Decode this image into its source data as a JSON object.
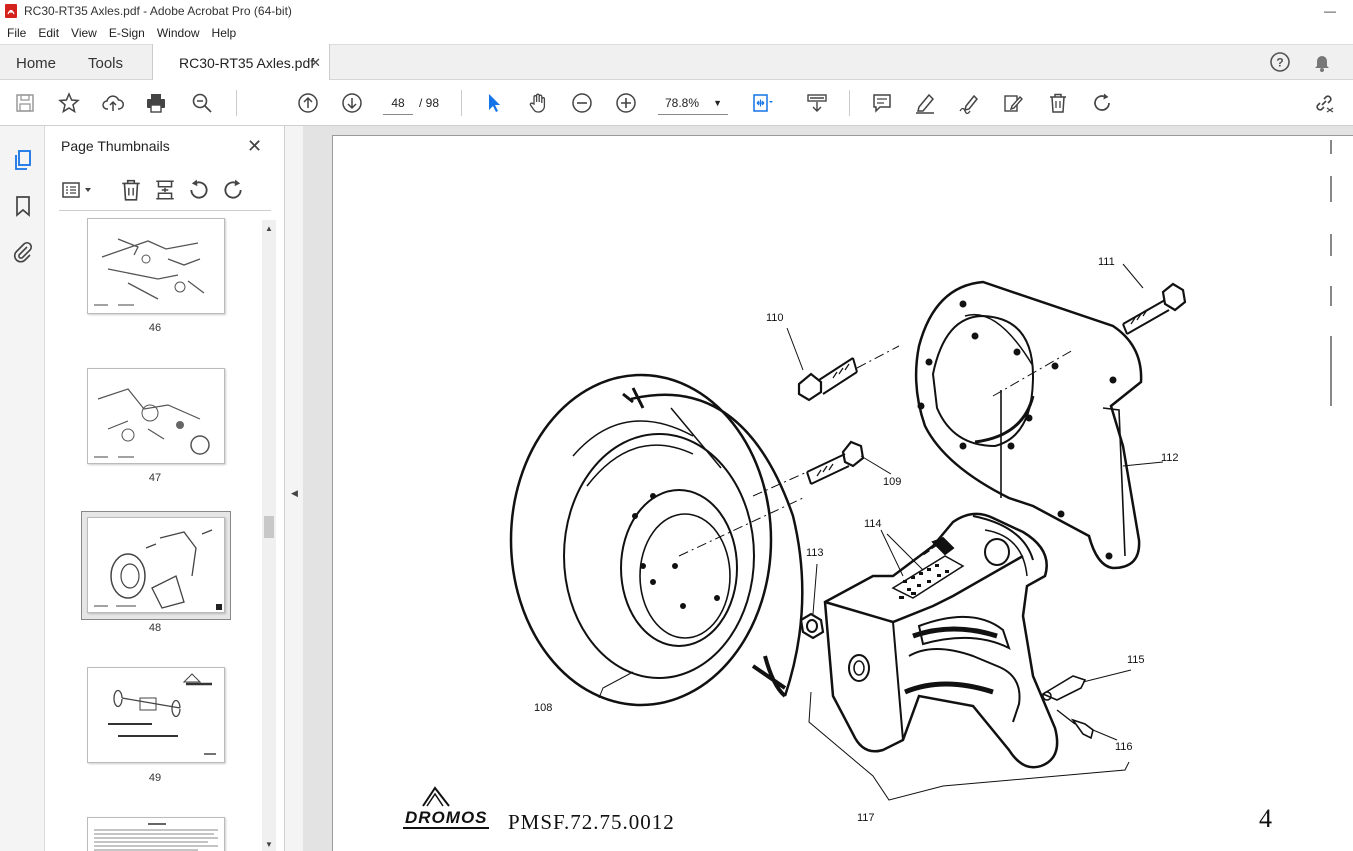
{
  "window": {
    "title": "RC30-RT35 Axles.pdf - Adobe Acrobat Pro (64-bit)"
  },
  "menu": [
    "File",
    "Edit",
    "View",
    "E-Sign",
    "Window",
    "Help"
  ],
  "tabs": {
    "home": "Home",
    "tools": "Tools",
    "document": "RC30-RT35 Axles.pdf"
  },
  "toolbar": {
    "current_page": "48",
    "total_pages": "/ 98",
    "zoom": "78.8%"
  },
  "thumbnails": {
    "title": "Page Thumbnails",
    "pages": [
      {
        "label": "46"
      },
      {
        "label": "47"
      },
      {
        "label": "48",
        "selected": true
      },
      {
        "label": "49"
      }
    ]
  },
  "document": {
    "callouts": [
      "111",
      "110",
      "112",
      "109",
      "114",
      "113",
      "115",
      "108",
      "116",
      "117"
    ],
    "brand": "DROMOS",
    "code": "PMSF.72.75.0012",
    "page_number": "4"
  },
  "colors": {
    "accent": "#1473e6",
    "tabbar": "#f0f0f0",
    "viewer_bg": "#e3e3e3"
  }
}
